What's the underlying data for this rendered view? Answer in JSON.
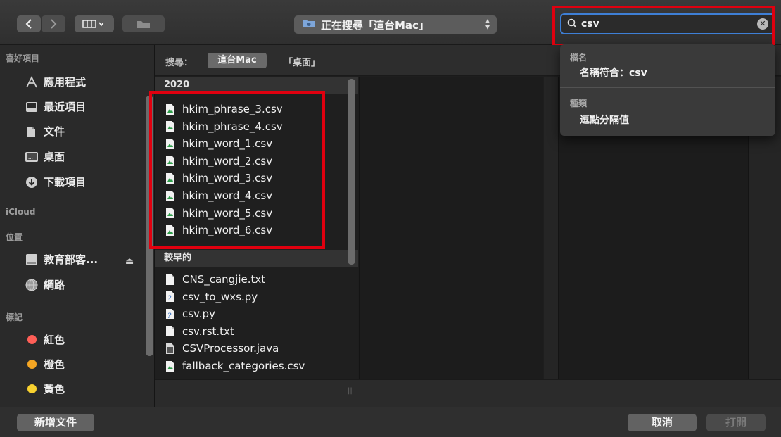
{
  "toolbar": {
    "scope_popup": "正在搜尋「這台Mac」",
    "search_value": "csv"
  },
  "sidebar": {
    "favorites_header": "喜好項目",
    "favorites": [
      {
        "label": "應用程式",
        "icon": "applications-icon"
      },
      {
        "label": "最近項目",
        "icon": "recents-icon"
      },
      {
        "label": "文件",
        "icon": "documents-icon"
      },
      {
        "label": "桌面",
        "icon": "desktop-icon"
      },
      {
        "label": "下載項目",
        "icon": "downloads-icon"
      }
    ],
    "icloud_header": "iCloud",
    "locations_header": "位置",
    "locations": [
      {
        "label": "教育部客...",
        "icon": "disk-icon"
      },
      {
        "label": "網路",
        "icon": "network-icon"
      }
    ],
    "tags_header": "標記",
    "tags": [
      {
        "label": "紅色",
        "color": "#ff5f57"
      },
      {
        "label": "橙色",
        "color": "#f5a623"
      },
      {
        "label": "黃色",
        "color": "#f8d12f"
      }
    ]
  },
  "scopebar": {
    "label": "搜尋：",
    "active": "這台Mac",
    "alternative": "「桌面」"
  },
  "results": {
    "group_2020": "2020",
    "files_2020": [
      "hkim_phrase_3.csv",
      "hkim_phrase_4.csv",
      "hkim_word_1.csv",
      "hkim_word_2.csv",
      "hkim_word_3.csv",
      "hkim_word_4.csv",
      "hkim_word_5.csv",
      "hkim_word_6.csv"
    ],
    "group_earlier": "較早的",
    "files_earlier": [
      {
        "name": "CNS_cangjie.txt",
        "kind": "text"
      },
      {
        "name": "csv_to_wxs.py",
        "kind": "python"
      },
      {
        "name": "csv.py",
        "kind": "python"
      },
      {
        "name": "csv.rst.txt",
        "kind": "text"
      },
      {
        "name": "CSVProcessor.java",
        "kind": "java"
      },
      {
        "name": "fallback_categories.csv",
        "kind": "csv"
      }
    ]
  },
  "suggestions": {
    "filename_header": "檔名",
    "filename_item": "名稱符合：csv",
    "kind_header": "種類",
    "kind_item": "逗點分隔值"
  },
  "bottom": {
    "new_document": "新增文件",
    "cancel": "取消",
    "open": "打開"
  },
  "colors": {
    "highlight_red": "#e0000f",
    "focus_blue": "#3e7fd6"
  }
}
